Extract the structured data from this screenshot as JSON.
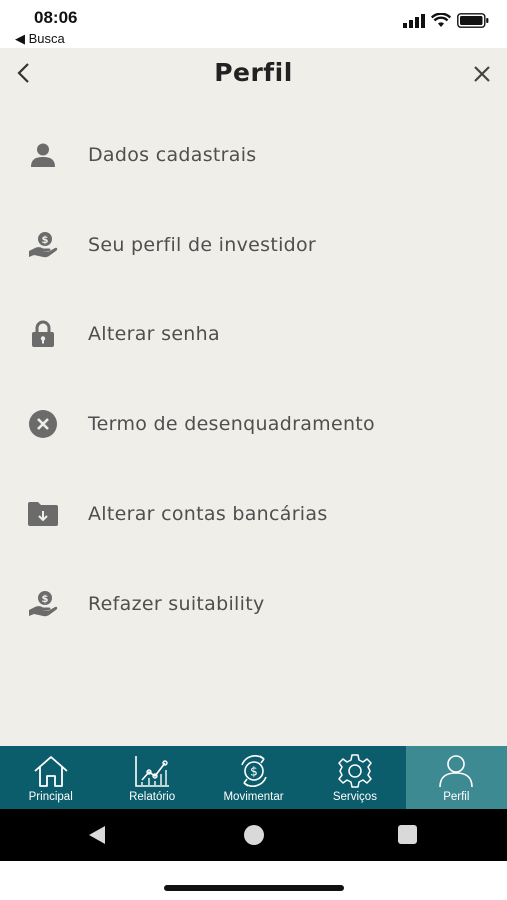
{
  "status_bar": {
    "time": "08:06",
    "back_app": "◀ Busca"
  },
  "header": {
    "title": "Perfil"
  },
  "menu": {
    "items": [
      {
        "label": "Dados cadastrais",
        "icon": "person-icon"
      },
      {
        "label": "Seu perfil de investidor",
        "icon": "hand-coin-icon"
      },
      {
        "label": "Alterar senha",
        "icon": "lock-icon"
      },
      {
        "label": "Termo de desenquadramento",
        "icon": "x-circle-icon"
      },
      {
        "label": "Alterar contas bancárias",
        "icon": "folder-download-icon"
      },
      {
        "label": "Refazer suitability",
        "icon": "hand-coin-icon"
      }
    ]
  },
  "tabbar": {
    "tabs": [
      {
        "label": "Principal",
        "icon": "home-icon"
      },
      {
        "label": "Relatório",
        "icon": "chart-icon"
      },
      {
        "label": "Movimentar",
        "icon": "money-transfer-icon"
      },
      {
        "label": "Serviços",
        "icon": "gear-icon"
      },
      {
        "label": "Perfil",
        "icon": "person-outline-icon",
        "active": true
      }
    ]
  },
  "colors": {
    "background": "#efeee9",
    "tabbar": "#0b5d6c",
    "tab_active": "#3e8a93",
    "icon_gray": "#6b6b6b"
  }
}
